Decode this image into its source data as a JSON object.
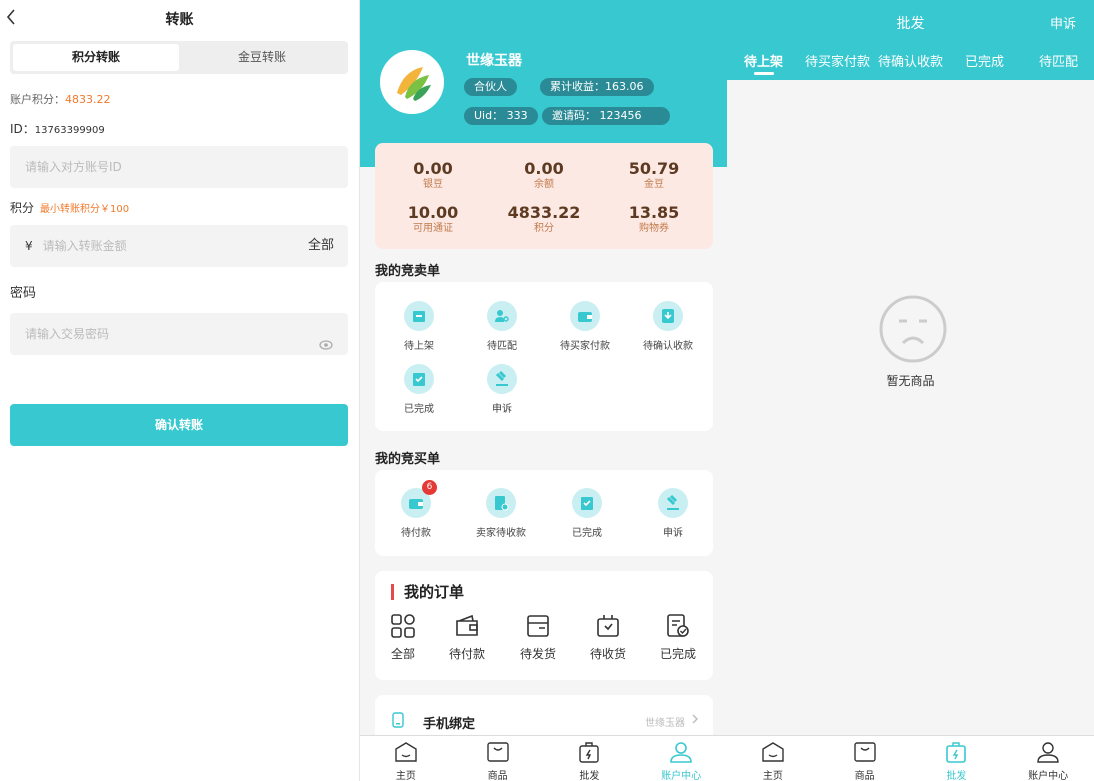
{
  "transfer": {
    "back_icon": "chevron-left-icon",
    "title": "转账",
    "tabs": [
      "积分转账",
      "金豆转账"
    ],
    "balance_label": "账户积分：",
    "balance_value": "4833.22",
    "id_label": "ID：",
    "id_value": "13763399909",
    "account_placeholder": "请输入对方账号ID",
    "points_label": "积分",
    "points_hint": "最小转账积分￥100",
    "currency": "¥",
    "amount_placeholder": "请输入转账金额",
    "all_label": "全部",
    "password_label": "密码",
    "password_placeholder": "请输入交易密码",
    "confirm_label": "确认转账"
  },
  "profile": {
    "name": "世缘玉器",
    "role": "合伙人",
    "earnings": "累计收益：163.06",
    "uid": "Uid： 333",
    "invite": "邀请码： 123456",
    "stats": [
      {
        "value": "0.00",
        "label": "银豆"
      },
      {
        "value": "0.00",
        "label": "余额"
      },
      {
        "value": "50.79",
        "label": "金豆"
      },
      {
        "value": "10.00",
        "label": "可用通证"
      },
      {
        "value": "4833.22",
        "label": "积分"
      },
      {
        "value": "13.85",
        "label": "购物券"
      }
    ],
    "sell_title": "我的竞卖单",
    "sell_items": [
      "待上架",
      "待匹配",
      "待买家付款",
      "待确认收款",
      "已完成",
      "申诉"
    ],
    "buy_title": "我的竞买单",
    "buy_items": [
      "待付款",
      "卖家待收款",
      "已完成",
      "申诉"
    ],
    "buy_badge": "6",
    "orders_title": "我的订单",
    "order_items": [
      "全部",
      "待付款",
      "待发货",
      "待收货",
      "已完成"
    ],
    "phone_title": "手机绑定",
    "phone_value": "世缘玉器"
  },
  "tabbar": [
    "主页",
    "商品",
    "批发",
    "账户中心"
  ],
  "wholesale": {
    "title": "批发",
    "right": "申诉",
    "tabs": [
      "待上架",
      "待买家付款",
      "待确认收款",
      "已完成",
      "待匹配"
    ],
    "empty": "暂无商品"
  },
  "colors": {
    "accent": "#38c8d0",
    "orange": "#f07a2d",
    "badge": "#e53935"
  }
}
